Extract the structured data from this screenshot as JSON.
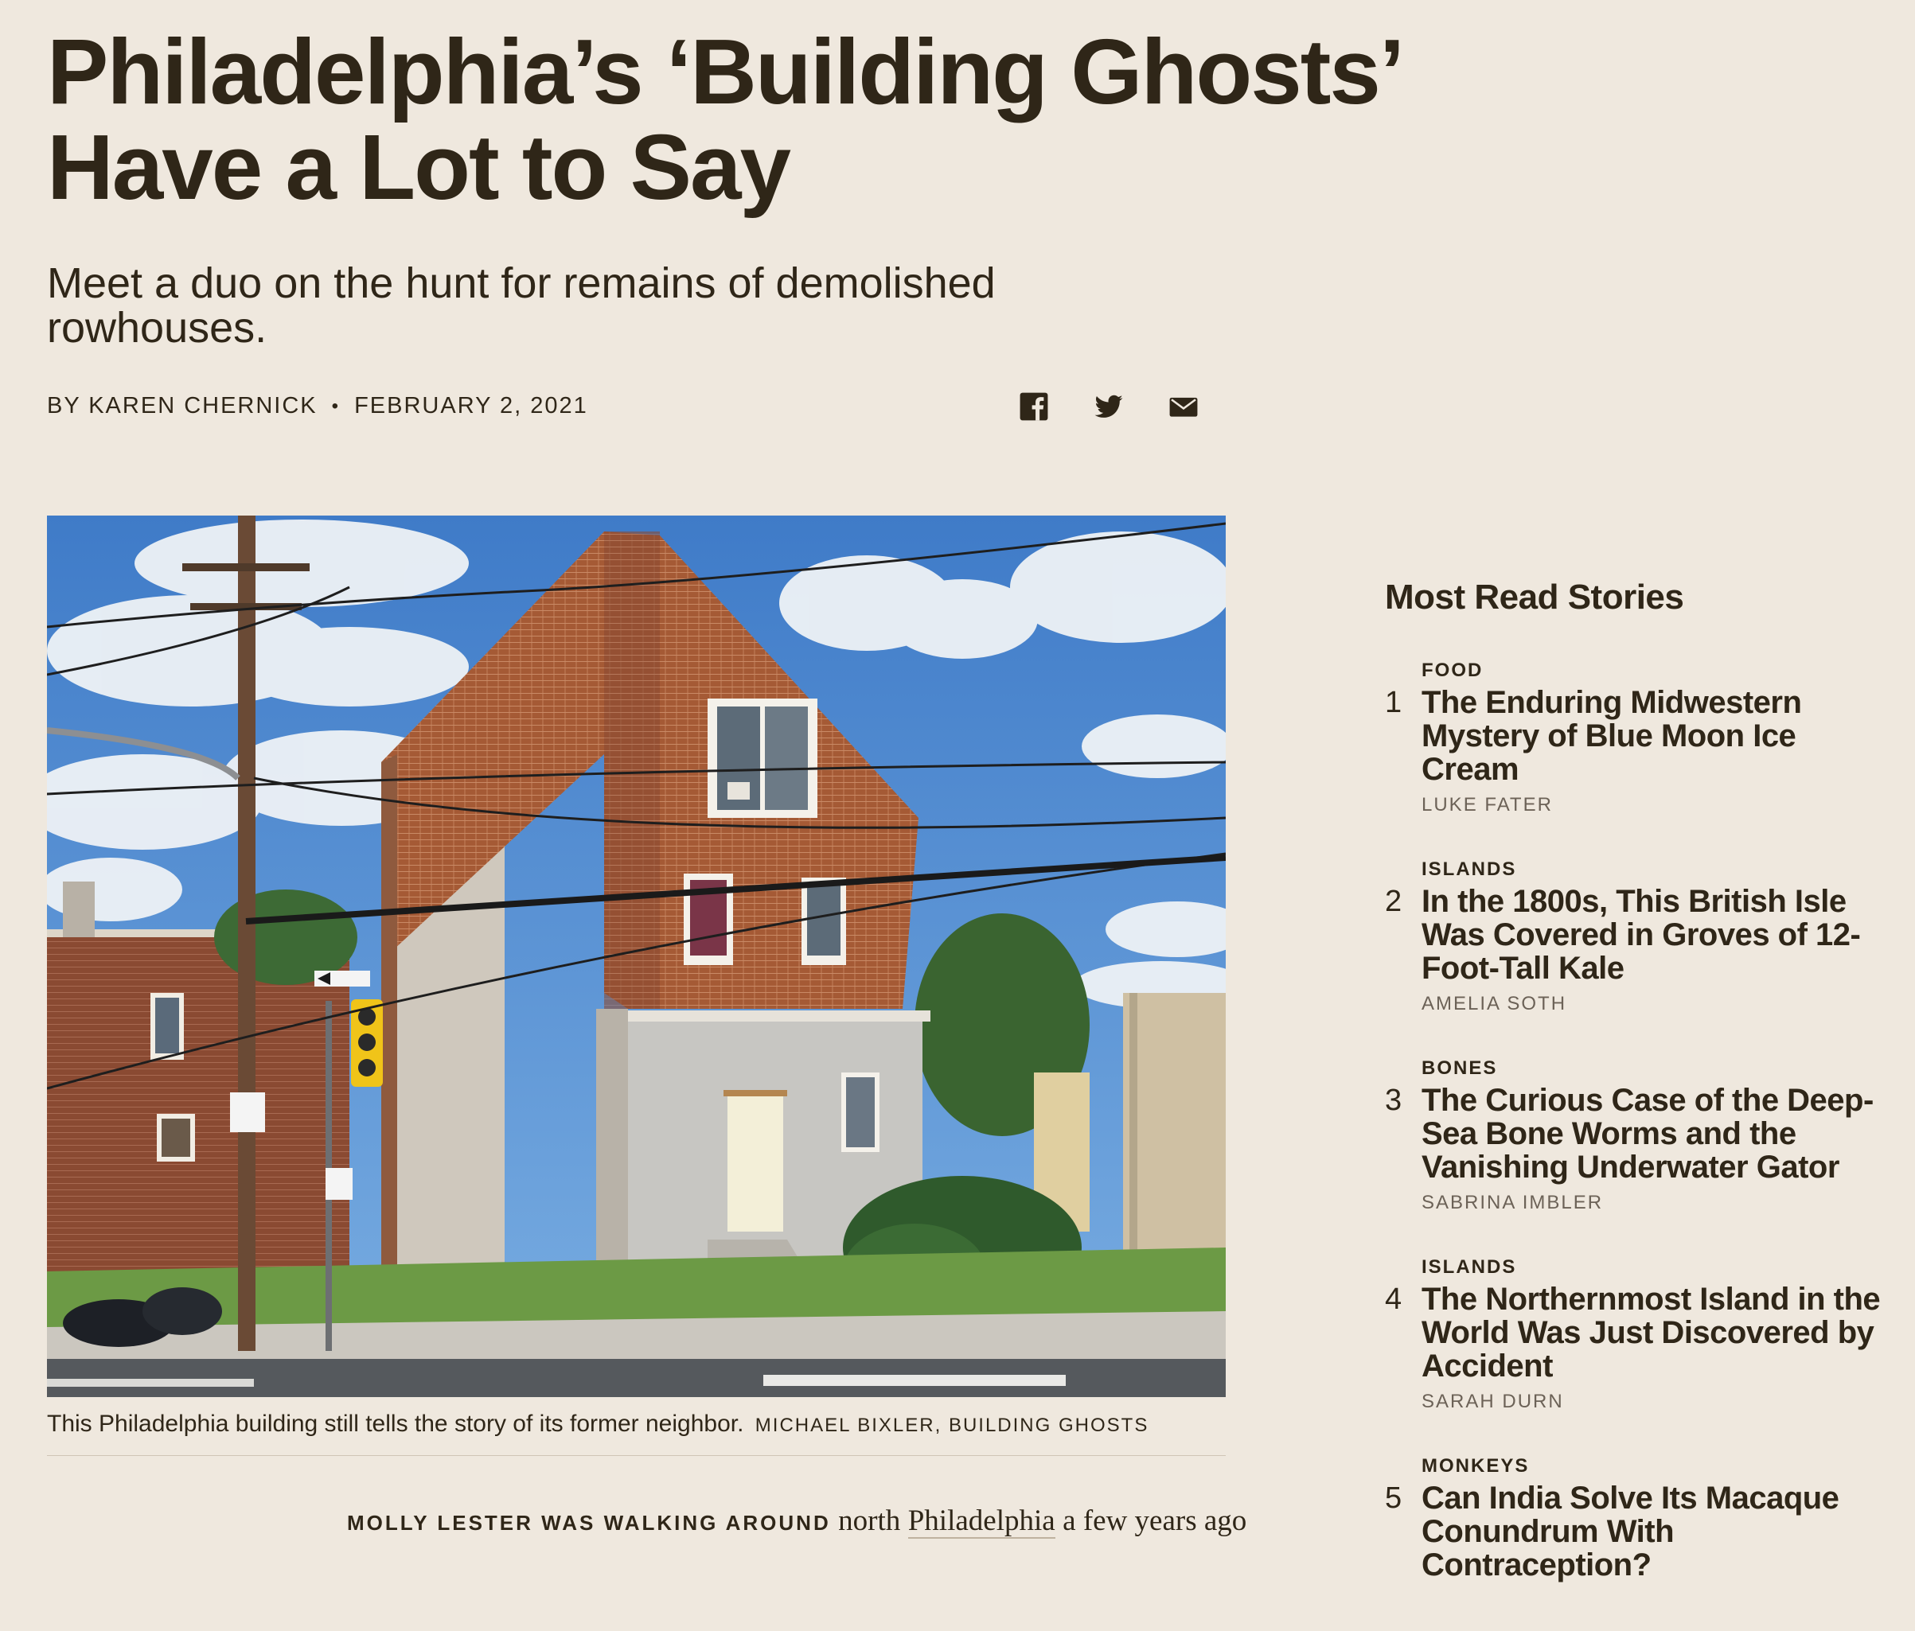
{
  "article": {
    "headline": "Philadelphia’s ‘Building Ghosts’ Have a Lot to Say",
    "dek": "Meet a duo on the hunt for remains of demolished rowhouses.",
    "byline": "BY KAREN CHERNICK",
    "separator": "•",
    "date": "FEBRUARY 2, 2021",
    "share_icons": [
      "facebook-icon",
      "twitter-icon",
      "email-icon"
    ],
    "caption_text": "This Philadelphia building still tells the story of its former neighbor.",
    "caption_credit": "MICHAEL BIXLER, BUILDING GHOSTS",
    "lede_caps": "MOLLY LESTER WAS WALKING AROUND",
    "lede_text_1": "north",
    "lede_link": "Philadelphia",
    "lede_text_2": "a few years ago"
  },
  "sidebar": {
    "heading": "Most Read Stories",
    "items": [
      {
        "rank": "1",
        "category": "FOOD",
        "title": "The Enduring Midwestern Mystery of Blue Moon Ice Cream",
        "author": "LUKE FATER"
      },
      {
        "rank": "2",
        "category": "ISLANDS",
        "title": "In the 1800s, This British Isle Was Covered in Groves of 12-Foot-Tall Kale",
        "author": "AMELIA SOTH"
      },
      {
        "rank": "3",
        "category": "BONES",
        "title": "The Curious Case of the Deep-Sea Bone Worms and the Vanishing Underwater Gator",
        "author": "SABRINA IMBLER"
      },
      {
        "rank": "4",
        "category": "ISLANDS",
        "title": "The Northernmost Island in the World Was Just Discovered by Accident",
        "author": "SARAH DURN"
      },
      {
        "rank": "5",
        "category": "MONKEYS",
        "title": "Can India Solve Its Macaque Conundrum With Contraception?",
        "author": ""
      }
    ]
  },
  "colors": {
    "background": "#efe8de",
    "text": "#2f2618",
    "muted": "#6c6257"
  }
}
